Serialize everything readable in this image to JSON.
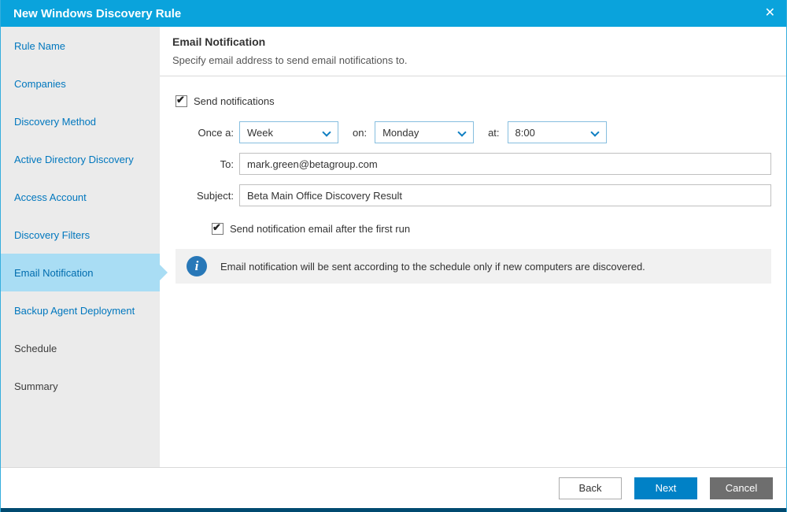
{
  "window": {
    "title": "New Windows Discovery Rule",
    "close_icon": "✕"
  },
  "sidebar": {
    "items": [
      {
        "label": "Rule Name",
        "state": "link"
      },
      {
        "label": "Companies",
        "state": "link"
      },
      {
        "label": "Discovery Method",
        "state": "link"
      },
      {
        "label": "Active Directory Discovery",
        "state": "link"
      },
      {
        "label": "Access Account",
        "state": "link"
      },
      {
        "label": "Discovery Filters",
        "state": "link"
      },
      {
        "label": "Email Notification",
        "state": "selected"
      },
      {
        "label": "Backup Agent Deployment",
        "state": "link"
      },
      {
        "label": "Schedule",
        "state": "pending"
      },
      {
        "label": "Summary",
        "state": "pending"
      }
    ]
  },
  "content": {
    "heading": "Email Notification",
    "subheading": "Specify email address to send email notifications to.",
    "send_notifications": {
      "label": "Send notifications",
      "checked": true
    },
    "schedule": {
      "once_label": "Once a:",
      "frequency": "Week",
      "on_label": "on:",
      "day": "Monday",
      "at_label": "at:",
      "time": "8:00"
    },
    "to": {
      "label": "To:",
      "value": "mark.green@betagroup.com"
    },
    "subject": {
      "label": "Subject:",
      "value": "Beta Main Office Discovery Result"
    },
    "first_run": {
      "label": "Send notification email after the first run",
      "checked": true
    },
    "info": {
      "text": "Email notification will be sent according to the schedule only if new computers are discovered."
    }
  },
  "footer": {
    "back": "Back",
    "next": "Next",
    "cancel": "Cancel"
  },
  "colors": {
    "titlebar": "#0AA3DC",
    "accent_button": "#0081C6",
    "sidebar_selected": "#A9DDF4",
    "sidebar_link": "#0077BE",
    "info_icon": "#2878B8",
    "bottom_strip": "#004A70"
  }
}
